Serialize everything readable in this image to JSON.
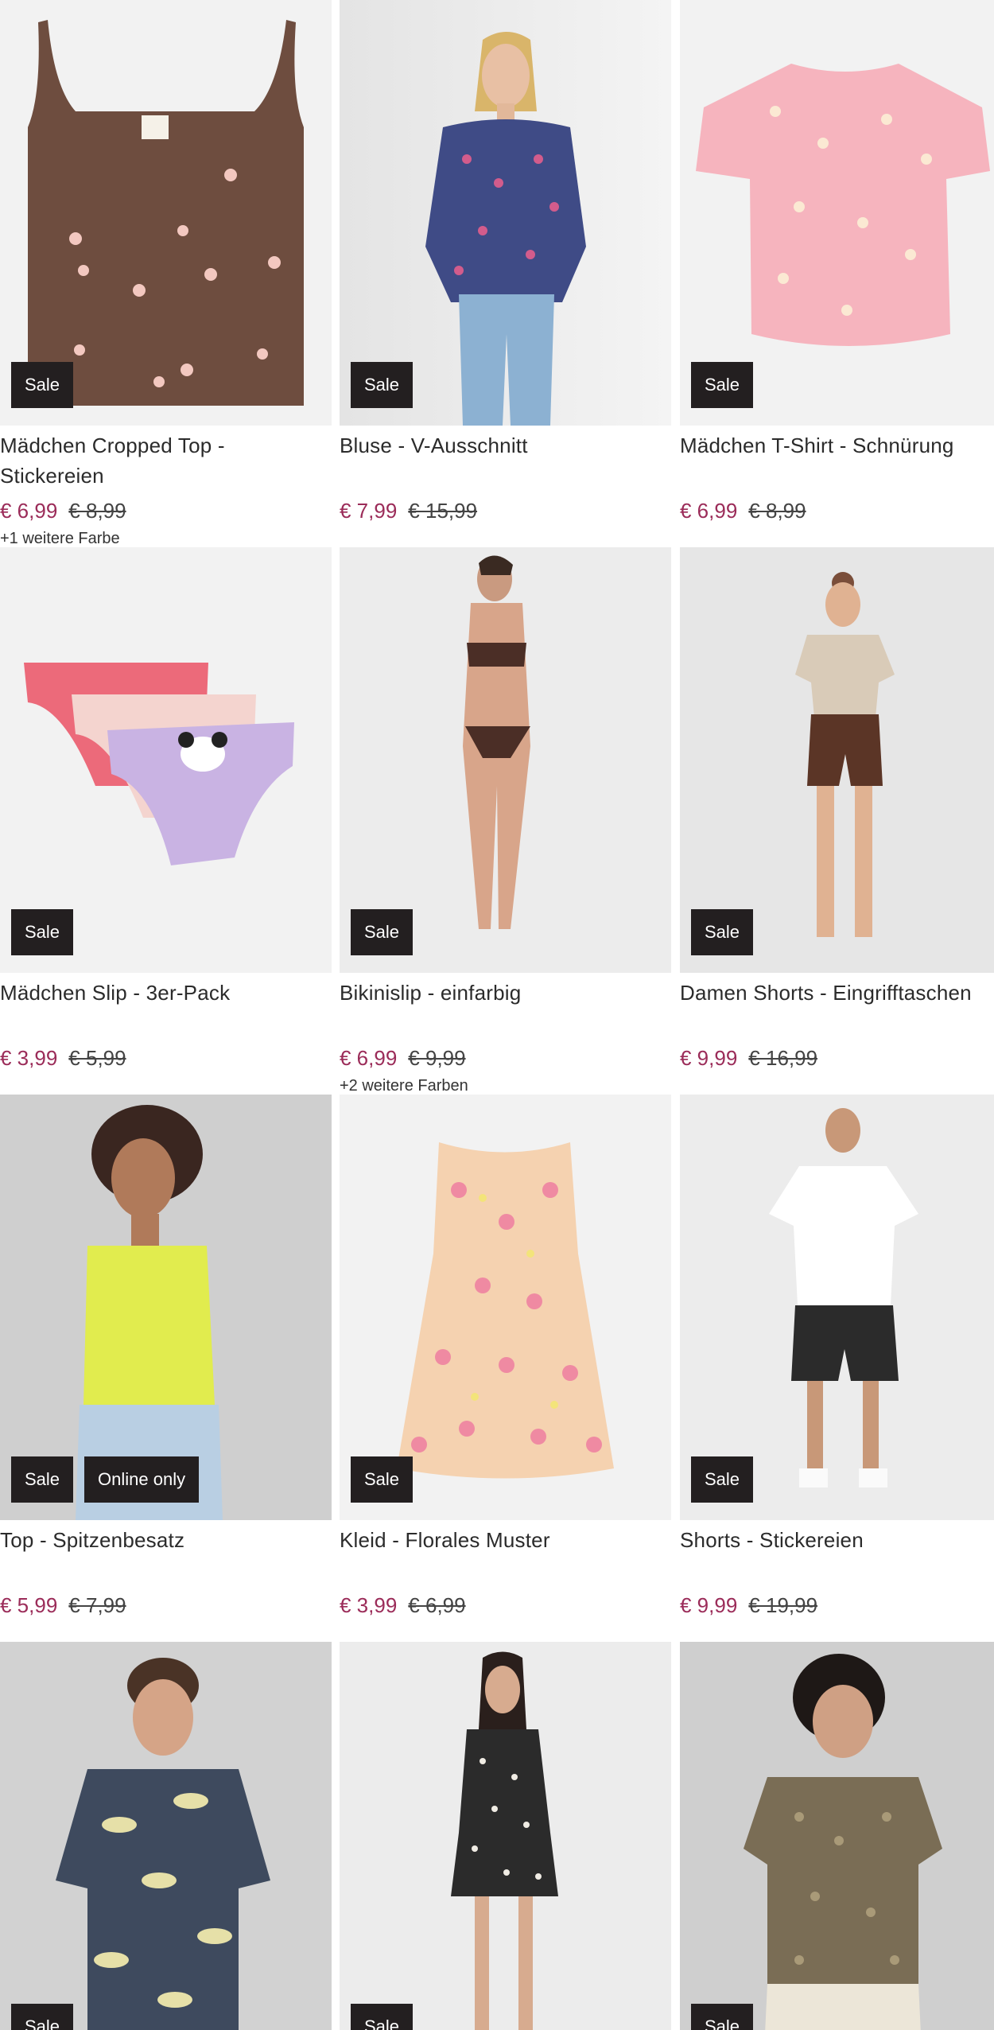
{
  "products": [
    {
      "title": "Mädchen Cropped Top - Stickereien",
      "price": "€ 6,99",
      "old_price": "€ 8,99",
      "colors": "+1 weitere Farbe",
      "badges": [
        "Sale"
      ],
      "bg": "#f2f2f2"
    },
    {
      "title": "Bluse - V-Ausschnitt",
      "price": "€ 7,99",
      "old_price": "€ 15,99",
      "colors": "",
      "badges": [
        "Sale"
      ],
      "bg": "#ececec"
    },
    {
      "title": "Mädchen T-Shirt - Schnürung",
      "price": "€ 6,99",
      "old_price": "€ 8,99",
      "colors": "",
      "badges": [
        "Sale"
      ],
      "bg": "#f2f2f2"
    },
    {
      "title": "Mädchen Slip - 3er-Pack",
      "price": "€ 3,99",
      "old_price": "€ 5,99",
      "colors": "",
      "badges": [
        "Sale"
      ],
      "bg": "#f2f2f2"
    },
    {
      "title": "Bikinislip - einfarbig",
      "price": "€ 6,99",
      "old_price": "€ 9,99",
      "colors": "+2 weitere Farben",
      "badges": [
        "Sale"
      ],
      "bg": "#ececec"
    },
    {
      "title": "Damen Shorts - Eingrifftaschen",
      "price": "€ 9,99",
      "old_price": "€ 16,99",
      "colors": "",
      "badges": [
        "Sale"
      ],
      "bg": "#e6e6e6"
    },
    {
      "title": "Top - Spitzenbesatz",
      "price": "€ 5,99",
      "old_price": "€ 7,99",
      "colors": "",
      "badges": [
        "Sale",
        "Online only"
      ],
      "bg": "#cfcfcf"
    },
    {
      "title": "Kleid - Florales Muster",
      "price": "€ 3,99",
      "old_price": "€ 6,99",
      "colors": "",
      "badges": [
        "Sale"
      ],
      "bg": "#f2f2f2"
    },
    {
      "title": "Shorts - Stickereien",
      "price": "€ 9,99",
      "old_price": "€ 19,99",
      "colors": "",
      "badges": [
        "Sale"
      ],
      "bg": "#ececec"
    },
    {
      "title": "",
      "price": "",
      "old_price": "",
      "colors": "",
      "badges": [
        "Sale"
      ],
      "bg": "#d2d2d2"
    },
    {
      "title": "",
      "price": "",
      "old_price": "",
      "colors": "",
      "badges": [
        "Sale"
      ],
      "bg": "#ececec"
    },
    {
      "title": "",
      "price": "",
      "old_price": "",
      "colors": "",
      "badges": [
        "Sale"
      ],
      "bg": "#cfcfcf"
    }
  ],
  "icons": {
    "p0": "brown-floral-crop-top-image",
    "p1": "floral-blouse-model-image",
    "p2": "pink-daisy-tshirt-image",
    "p3": "girls-slip-3pack-image",
    "p4": "brown-bikini-model-image",
    "p5": "brown-shorts-model-image",
    "p6": "yellow-lace-top-model-image",
    "p7": "floral-dress-image",
    "p8": "white-tshirt-black-shorts-model-image",
    "p9": "leaf-print-shirt-model-image",
    "p10": "black-floral-dress-model-image",
    "p11": "khaki-print-top-model-image"
  }
}
